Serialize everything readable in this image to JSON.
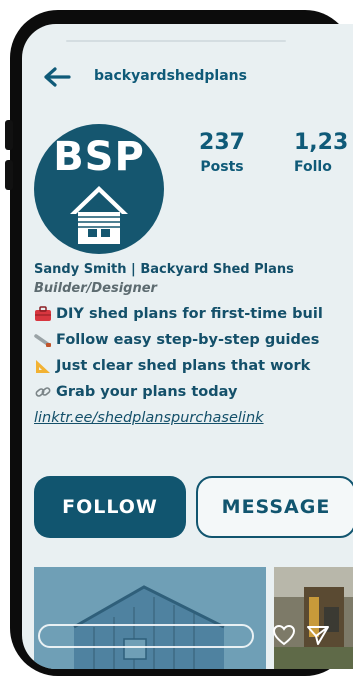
{
  "header": {
    "username": "backyardshedplans"
  },
  "avatar": {
    "logo_text": "BSP"
  },
  "stats": [
    {
      "value": "237",
      "label": "Posts"
    },
    {
      "value": "1,23",
      "label": "Follo"
    }
  ],
  "bio": {
    "name": "Sandy Smith | Backyard Shed Plans",
    "role": "Builder/Designer",
    "lines": [
      "DIY shed plans for first-time buil",
      "Follow easy step-by-step guides",
      "Just clear shed plans that work",
      "Grab your plans today"
    ],
    "link": "linktr.ee/shedplanspurchaselink"
  },
  "actions": {
    "follow_label": "FOLLOW",
    "message_label": "MESSAGE"
  },
  "colors": {
    "brand": "#11556f",
    "background": "#e9f0f2"
  }
}
